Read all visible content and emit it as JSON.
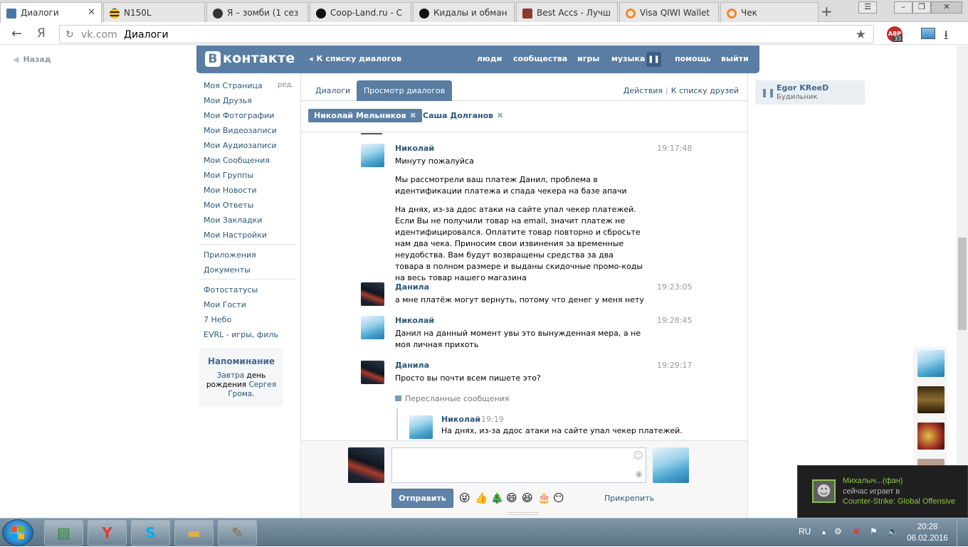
{
  "browser": {
    "tabs": [
      {
        "label": "Диалоги",
        "active": true
      },
      {
        "label": "N150L"
      },
      {
        "label": "Я – зомби (1 сез"
      },
      {
        "label": "Coop-Land.ru - С"
      },
      {
        "label": "Кидалы и обман"
      },
      {
        "label": "Best Accs - Лучш"
      },
      {
        "label": "Visa QIWI Wallet"
      },
      {
        "label": "Чек"
      }
    ],
    "new_tab": "+",
    "address": {
      "domain": "vk.com",
      "title": "Диалоги"
    },
    "yandex_letter": "Я",
    "adblock_count": "33"
  },
  "page": {
    "back_label": "Назад",
    "header": {
      "logo_text": "контакте",
      "logo_letter": "B",
      "back_to_list": "К списку диалогов",
      "nav": [
        "люди",
        "сообщества",
        "игры",
        "музыка",
        "помощь",
        "выйти"
      ]
    },
    "left_menu": {
      "items": [
        "Моя Страница",
        "Мои Друзья",
        "Мои Фотографии",
        "Мои Видеозаписи",
        "Мои Аудиозаписи",
        "Мои Сообщения",
        "Мои Группы",
        "Мои Новости",
        "Мои Ответы",
        "Мои Закладки",
        "Мои Настройки"
      ],
      "edit_label": "ред.",
      "group2": [
        "Приложения",
        "Документы"
      ],
      "group3": [
        "Фотостатусы",
        "Мои Гости",
        "7 Небо",
        "EVRL - игры, филь"
      ]
    },
    "reminder": {
      "title": "Напоминание",
      "line1_link": "Завтра",
      "line1_text": " день рождения ",
      "line1_name": "Сергея Грома",
      "line1_end": "."
    },
    "dialog": {
      "tabs": [
        "Диалоги",
        "Просмотр диалогов"
      ],
      "actions": [
        "Действия",
        "К списку друзей"
      ],
      "chips": [
        "Николай Мельников",
        "Саша Долганов"
      ],
      "messages": [
        {
          "author": "Николай",
          "time": "19:17:48",
          "paragraphs": [
            "Минуту пожалуйса",
            "Мы рассмотрели ваш платеж Данил, проблема в идентификации платежа и спада чекера на базе апачи",
            "На днях, из-за ддос атаки на сайте упал чекер платежей. Если Вы не получили товар на email, значит платеж не идентифицировался. Оплатите товар повторно и сбросьте нам два чека. Приносим свои извинения за временные неудобства. Вам будут возвращены средства за два товара в полном размере и выданы скидочные промо-коды на весь товар нашего магазина"
          ]
        },
        {
          "author": "Данила",
          "time": "19:23:05",
          "paragraphs": [
            "а мне платёж могут вернуть, потому что денег у меня нету"
          ]
        },
        {
          "author": "Николай",
          "time": "19:28:45",
          "paragraphs": [
            "Данил на данный момент увы это вынужденная мера, а не моя личная прихоть"
          ]
        },
        {
          "author": "Данила",
          "time": "19:29:17",
          "paragraphs": [
            "Просто вы почти всем пишете это?"
          ]
        }
      ],
      "forwarded": {
        "label": "Пересланные сообщения",
        "author": "Николай",
        "time": "19:19",
        "text": "На днях, из-за ддос атаки на сайте упал чекер платежей."
      },
      "composer": {
        "send_label": "Отправить",
        "attach_label": "Прикрепить",
        "emojis": [
          "😜",
          "👍",
          "🎄",
          "😄",
          "😆",
          "🎂",
          "😶"
        ]
      }
    },
    "audio": {
      "artist": "Egor KReeD",
      "track": "Будильник"
    }
  },
  "steam": {
    "name": "Михалыч...(фан)",
    "status": "сейчас играет в",
    "game": "Counter-Strike: Global Offensive"
  },
  "taskbar": {
    "lang": "RU",
    "time": "20:28",
    "date": "06.02.2016"
  }
}
